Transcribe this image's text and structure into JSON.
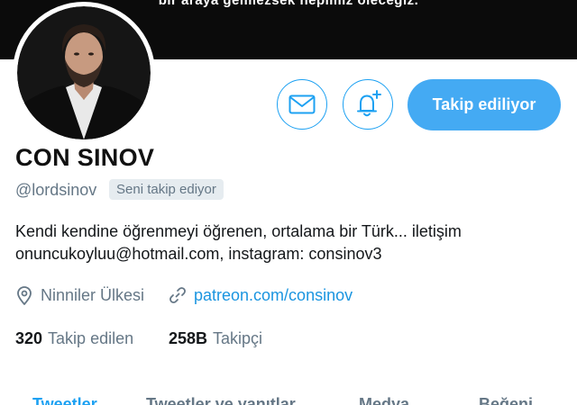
{
  "banner": {
    "text": "bir araya gelmezsek hepimiz öleceğiz."
  },
  "profile": {
    "display_name": "CON SINOV",
    "handle": "@lordsinov",
    "follows_you_badge": "Seni takip ediyor",
    "bio_line1": "Kendi kendine öğrenmeyi öğrenen, ortalama bir Türk... iletişim",
    "bio_line2": "onuncukoyluu@hotmail.com, instagram: consinov3",
    "location": "Ninniler Ülkesi",
    "website": "patreon.com/consinov"
  },
  "actions": {
    "message_icon": "envelope-icon",
    "notify_icon": "bell-plus-icon",
    "follow_label": "Takip ediliyor"
  },
  "stats": {
    "following_count": "320",
    "following_label": "Takip edilen",
    "followers_count": "258B",
    "followers_label": "Takipçi"
  },
  "tabs": [
    {
      "label": "Tweetler",
      "active": true
    },
    {
      "label": "Tweetler ve yanıtlar",
      "active": false
    },
    {
      "label": "Medya",
      "active": false
    },
    {
      "label": "Beğeni",
      "active": false
    }
  ],
  "colors": {
    "accent": "#1da1f2",
    "follow_button": "#44aaf3",
    "link": "#1b95e0",
    "secondary_text": "#657786"
  }
}
